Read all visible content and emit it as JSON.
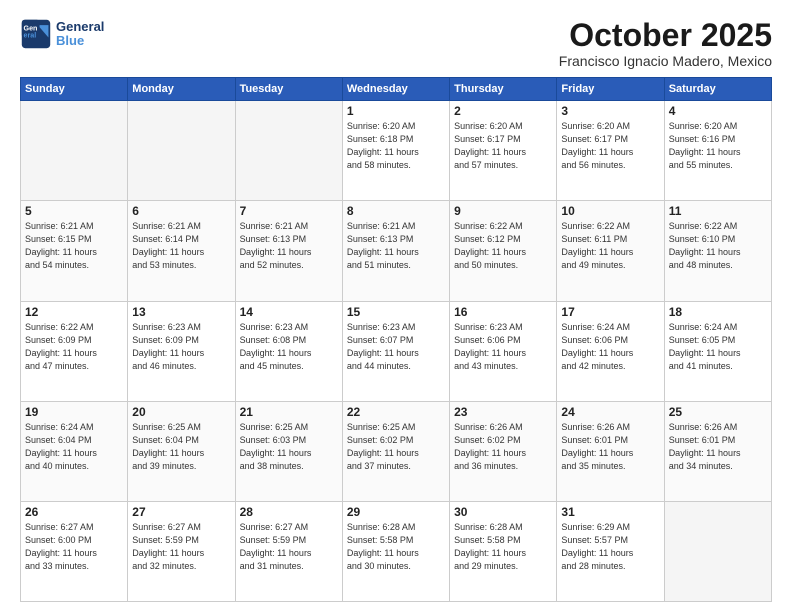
{
  "logo": {
    "line1": "General",
    "line2": "Blue"
  },
  "title": "October 2025",
  "subtitle": "Francisco Ignacio Madero, Mexico",
  "weekdays": [
    "Sunday",
    "Monday",
    "Tuesday",
    "Wednesday",
    "Thursday",
    "Friday",
    "Saturday"
  ],
  "weeks": [
    [
      {
        "day": "",
        "info": ""
      },
      {
        "day": "",
        "info": ""
      },
      {
        "day": "",
        "info": ""
      },
      {
        "day": "1",
        "info": "Sunrise: 6:20 AM\nSunset: 6:18 PM\nDaylight: 11 hours\nand 58 minutes."
      },
      {
        "day": "2",
        "info": "Sunrise: 6:20 AM\nSunset: 6:17 PM\nDaylight: 11 hours\nand 57 minutes."
      },
      {
        "day": "3",
        "info": "Sunrise: 6:20 AM\nSunset: 6:17 PM\nDaylight: 11 hours\nand 56 minutes."
      },
      {
        "day": "4",
        "info": "Sunrise: 6:20 AM\nSunset: 6:16 PM\nDaylight: 11 hours\nand 55 minutes."
      }
    ],
    [
      {
        "day": "5",
        "info": "Sunrise: 6:21 AM\nSunset: 6:15 PM\nDaylight: 11 hours\nand 54 minutes."
      },
      {
        "day": "6",
        "info": "Sunrise: 6:21 AM\nSunset: 6:14 PM\nDaylight: 11 hours\nand 53 minutes."
      },
      {
        "day": "7",
        "info": "Sunrise: 6:21 AM\nSunset: 6:13 PM\nDaylight: 11 hours\nand 52 minutes."
      },
      {
        "day": "8",
        "info": "Sunrise: 6:21 AM\nSunset: 6:13 PM\nDaylight: 11 hours\nand 51 minutes."
      },
      {
        "day": "9",
        "info": "Sunrise: 6:22 AM\nSunset: 6:12 PM\nDaylight: 11 hours\nand 50 minutes."
      },
      {
        "day": "10",
        "info": "Sunrise: 6:22 AM\nSunset: 6:11 PM\nDaylight: 11 hours\nand 49 minutes."
      },
      {
        "day": "11",
        "info": "Sunrise: 6:22 AM\nSunset: 6:10 PM\nDaylight: 11 hours\nand 48 minutes."
      }
    ],
    [
      {
        "day": "12",
        "info": "Sunrise: 6:22 AM\nSunset: 6:09 PM\nDaylight: 11 hours\nand 47 minutes."
      },
      {
        "day": "13",
        "info": "Sunrise: 6:23 AM\nSunset: 6:09 PM\nDaylight: 11 hours\nand 46 minutes."
      },
      {
        "day": "14",
        "info": "Sunrise: 6:23 AM\nSunset: 6:08 PM\nDaylight: 11 hours\nand 45 minutes."
      },
      {
        "day": "15",
        "info": "Sunrise: 6:23 AM\nSunset: 6:07 PM\nDaylight: 11 hours\nand 44 minutes."
      },
      {
        "day": "16",
        "info": "Sunrise: 6:23 AM\nSunset: 6:06 PM\nDaylight: 11 hours\nand 43 minutes."
      },
      {
        "day": "17",
        "info": "Sunrise: 6:24 AM\nSunset: 6:06 PM\nDaylight: 11 hours\nand 42 minutes."
      },
      {
        "day": "18",
        "info": "Sunrise: 6:24 AM\nSunset: 6:05 PM\nDaylight: 11 hours\nand 41 minutes."
      }
    ],
    [
      {
        "day": "19",
        "info": "Sunrise: 6:24 AM\nSunset: 6:04 PM\nDaylight: 11 hours\nand 40 minutes."
      },
      {
        "day": "20",
        "info": "Sunrise: 6:25 AM\nSunset: 6:04 PM\nDaylight: 11 hours\nand 39 minutes."
      },
      {
        "day": "21",
        "info": "Sunrise: 6:25 AM\nSunset: 6:03 PM\nDaylight: 11 hours\nand 38 minutes."
      },
      {
        "day": "22",
        "info": "Sunrise: 6:25 AM\nSunset: 6:02 PM\nDaylight: 11 hours\nand 37 minutes."
      },
      {
        "day": "23",
        "info": "Sunrise: 6:26 AM\nSunset: 6:02 PM\nDaylight: 11 hours\nand 36 minutes."
      },
      {
        "day": "24",
        "info": "Sunrise: 6:26 AM\nSunset: 6:01 PM\nDaylight: 11 hours\nand 35 minutes."
      },
      {
        "day": "25",
        "info": "Sunrise: 6:26 AM\nSunset: 6:01 PM\nDaylight: 11 hours\nand 34 minutes."
      }
    ],
    [
      {
        "day": "26",
        "info": "Sunrise: 6:27 AM\nSunset: 6:00 PM\nDaylight: 11 hours\nand 33 minutes."
      },
      {
        "day": "27",
        "info": "Sunrise: 6:27 AM\nSunset: 5:59 PM\nDaylight: 11 hours\nand 32 minutes."
      },
      {
        "day": "28",
        "info": "Sunrise: 6:27 AM\nSunset: 5:59 PM\nDaylight: 11 hours\nand 31 minutes."
      },
      {
        "day": "29",
        "info": "Sunrise: 6:28 AM\nSunset: 5:58 PM\nDaylight: 11 hours\nand 30 minutes."
      },
      {
        "day": "30",
        "info": "Sunrise: 6:28 AM\nSunset: 5:58 PM\nDaylight: 11 hours\nand 29 minutes."
      },
      {
        "day": "31",
        "info": "Sunrise: 6:29 AM\nSunset: 5:57 PM\nDaylight: 11 hours\nand 28 minutes."
      },
      {
        "day": "",
        "info": ""
      }
    ]
  ]
}
